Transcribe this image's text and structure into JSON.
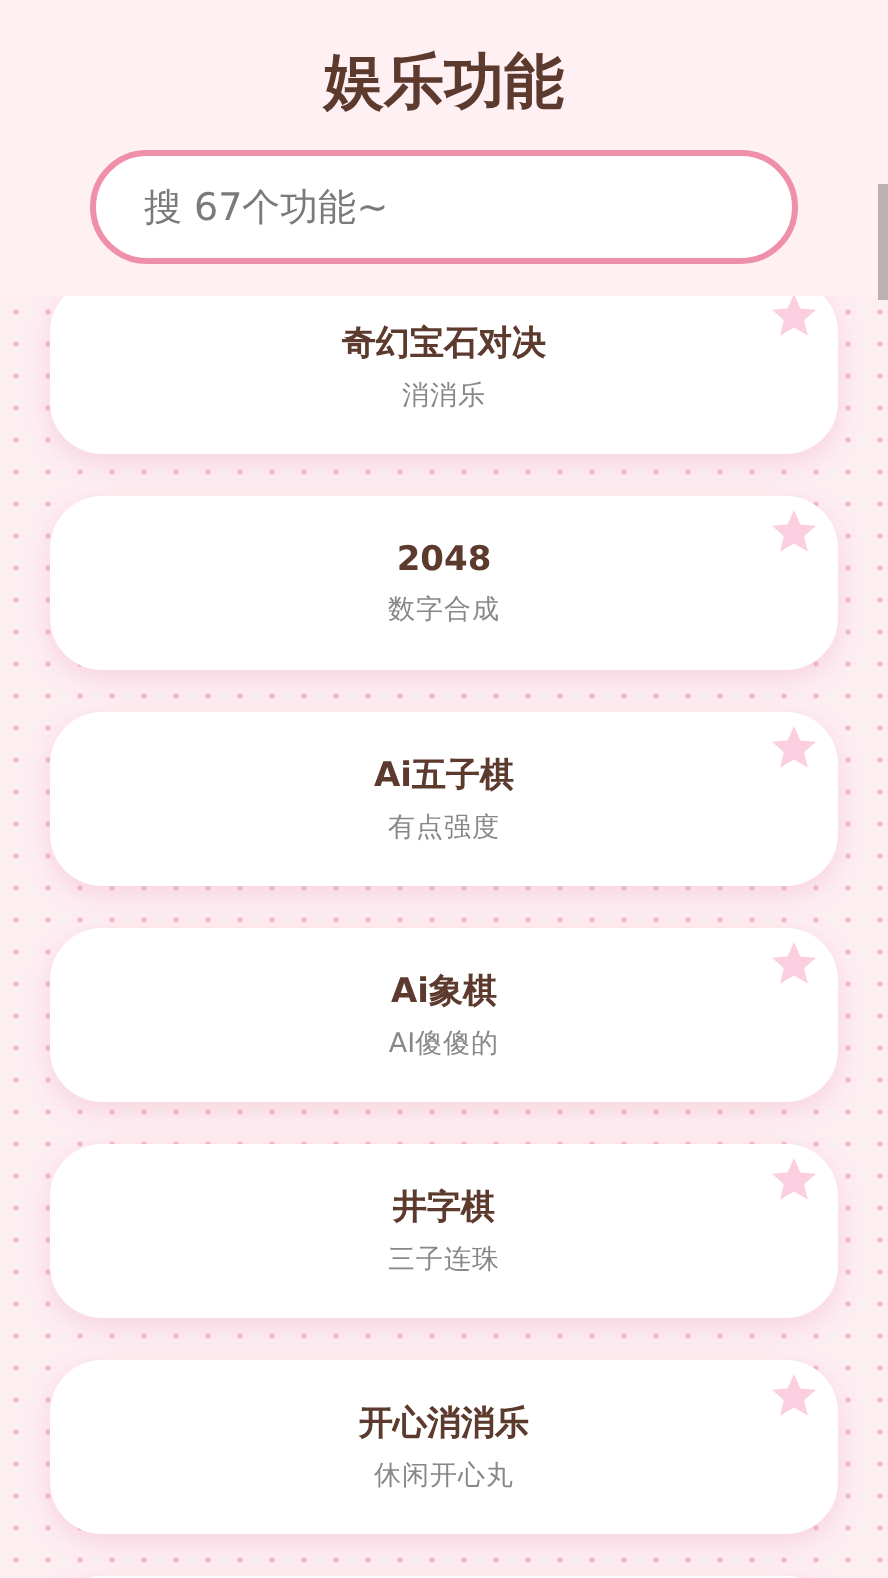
{
  "header": {
    "title": "娱乐功能",
    "search": {
      "placeholder": "搜 67个功能~"
    }
  },
  "items": [
    {
      "name": "奇幻宝石对决",
      "desc": "消消乐"
    },
    {
      "name": "2048",
      "desc": "数字合成"
    },
    {
      "name": "Ai五子棋",
      "desc": "有点强度"
    },
    {
      "name": "Ai象棋",
      "desc": "AI傻傻的"
    },
    {
      "name": "井字棋",
      "desc": "三子连珠"
    },
    {
      "name": "开心消消乐",
      "desc": "休闲开心丸"
    }
  ]
}
